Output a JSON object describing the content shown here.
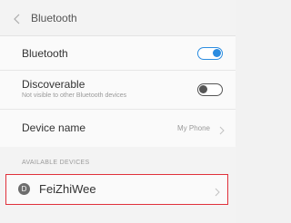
{
  "header": {
    "title": "Bluetooth"
  },
  "settings": {
    "bluetooth": {
      "label": "Bluetooth",
      "enabled": true
    },
    "discoverable": {
      "label": "Discoverable",
      "sublabel": "Not visible to other Bluetooth devices",
      "enabled": false
    },
    "device_name": {
      "label": "Device name",
      "value": "My Phone"
    }
  },
  "available_devices": {
    "header": "AVAILABLE DEVICES",
    "items": [
      {
        "avatar_letter": "D",
        "name": "FeiZhiWee"
      }
    ]
  },
  "colors": {
    "accent": "#2b8ce0",
    "highlight_border": "#e0303a"
  },
  "icons": {
    "back": "chevron-left-icon",
    "chevron": "chevron-right-icon",
    "device": "device-avatar-icon"
  }
}
